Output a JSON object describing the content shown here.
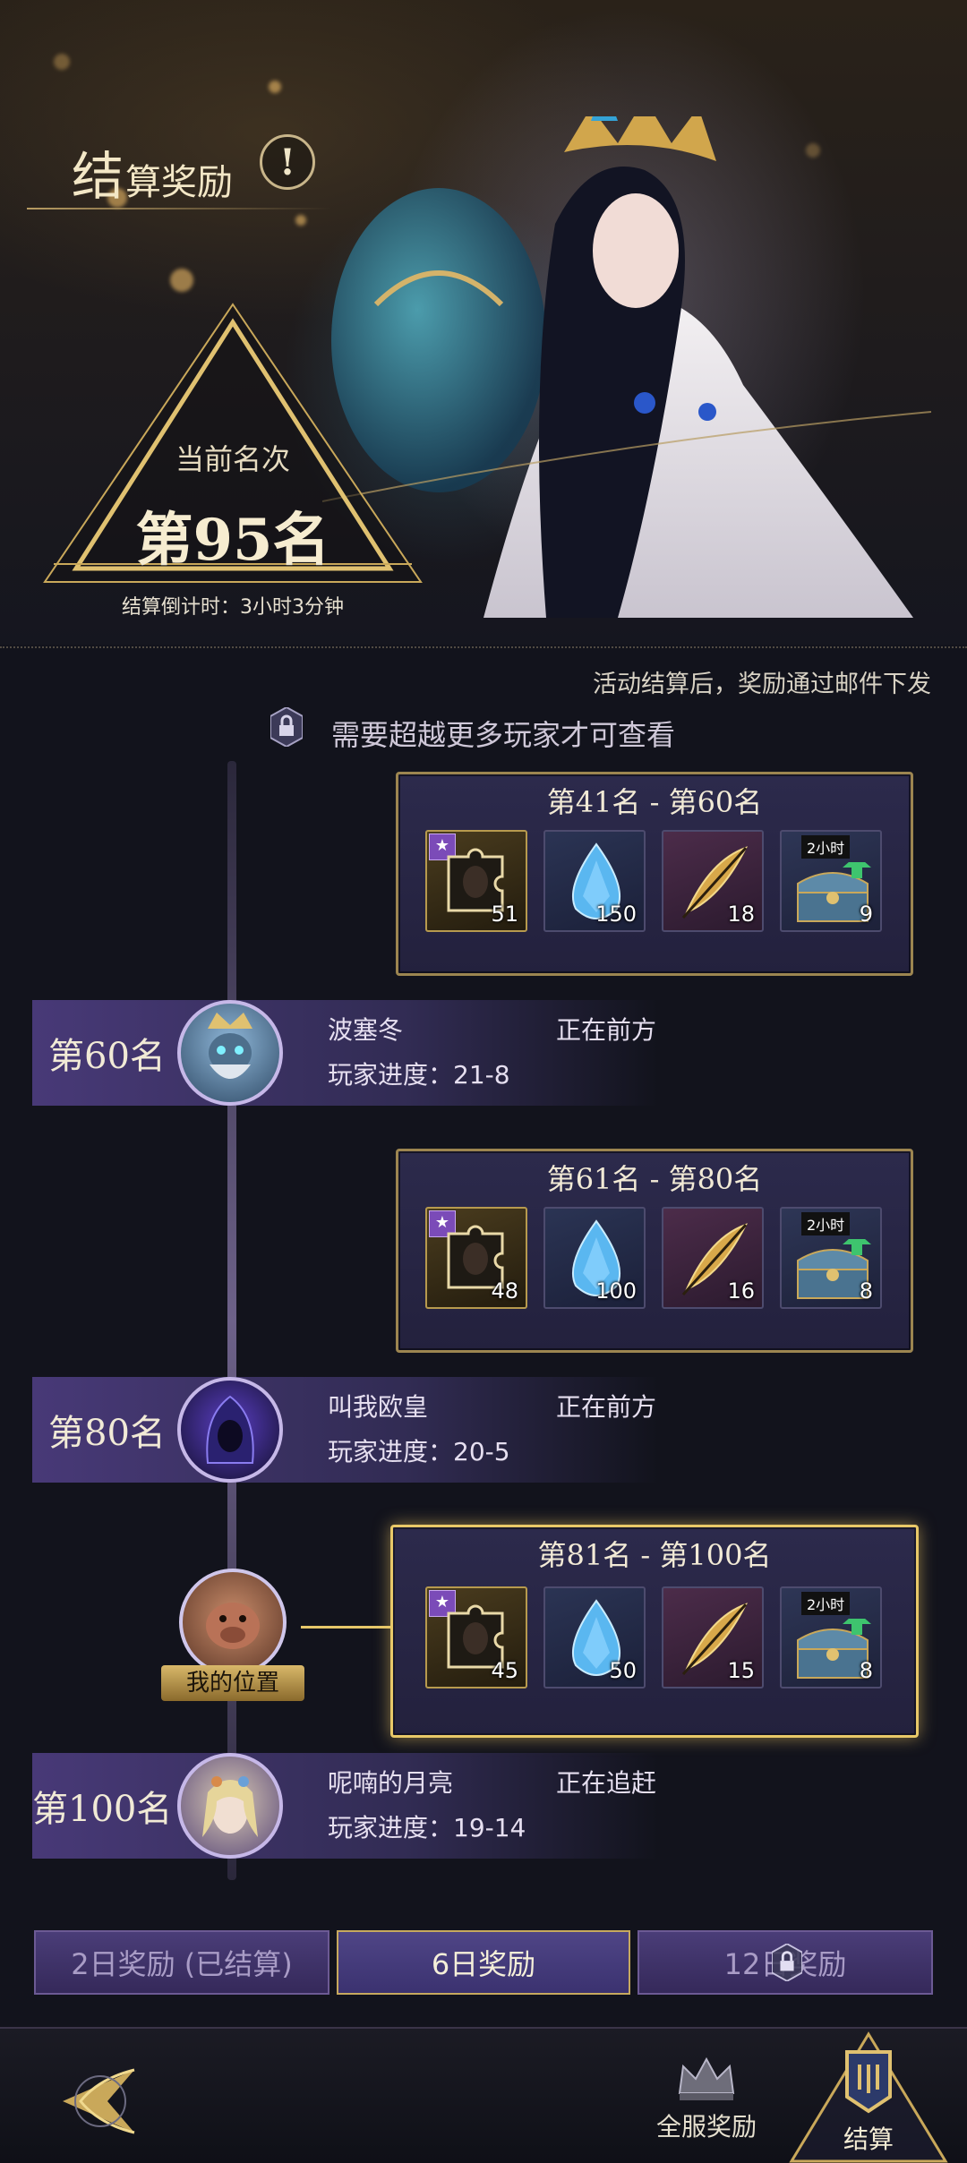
{
  "header": {
    "title_first_char": "结",
    "title_rest": "算奖励",
    "info_icon": "exclamation-icon",
    "rank_label": "当前名次",
    "rank_value": "第95名",
    "countdown": "结算倒计时：3小时3分钟"
  },
  "notes": {
    "mail": "活动结算后，奖励通过邮件下发",
    "locked": "需要超越更多玩家才可查看"
  },
  "tiers": [
    {
      "title": "第41名 - 第60名",
      "items": [
        {
          "icon": "puzzle-piece-icon",
          "count": "51"
        },
        {
          "icon": "blue-gem-icon",
          "count": "150"
        },
        {
          "icon": "golden-feather-icon",
          "count": "18"
        },
        {
          "icon": "treasure-chest-icon",
          "count": "9",
          "tag": "2小时"
        }
      ]
    },
    {
      "title": "第61名 - 第80名",
      "items": [
        {
          "icon": "puzzle-piece-icon",
          "count": "48"
        },
        {
          "icon": "blue-gem-icon",
          "count": "100"
        },
        {
          "icon": "golden-feather-icon",
          "count": "16"
        },
        {
          "icon": "treasure-chest-icon",
          "count": "8",
          "tag": "2小时"
        }
      ]
    },
    {
      "title": "第81名 - 第100名",
      "items": [
        {
          "icon": "puzzle-piece-icon",
          "count": "45"
        },
        {
          "icon": "blue-gem-icon",
          "count": "50"
        },
        {
          "icon": "golden-feather-icon",
          "count": "15"
        },
        {
          "icon": "treasure-chest-icon",
          "count": "8",
          "tag": "2小时"
        }
      ]
    }
  ],
  "players": [
    {
      "rank": "第60名",
      "name": "波塞冬",
      "status": "正在前方",
      "progress": "玩家进度：21-8"
    },
    {
      "rank": "第80名",
      "name": "叫我欧皇",
      "status": "正在前方",
      "progress": "玩家进度：20-5"
    },
    {
      "rank": "第100名",
      "name": "呢喃的月亮",
      "status": "正在追赶",
      "progress": "玩家进度：19-14"
    }
  ],
  "my_position_label": "我的位置",
  "tabs": [
    {
      "label": "2日奖励 (已结算)",
      "state": "settled"
    },
    {
      "label": "6日奖励",
      "state": "active"
    },
    {
      "label": "12日奖励",
      "state": "locked"
    }
  ],
  "bottom_nav": {
    "back_icon": "winged-arrow-back-icon",
    "server_label": "全服奖励",
    "server_icon": "crown-helmet-icon",
    "settle_label": "结算",
    "settle_icon": "banner-emblem-icon"
  },
  "colors": {
    "gold": "#c8a95e",
    "panel_bg": "#2c2a4c",
    "row_purple": "#5a4696",
    "background": "#12131c"
  }
}
